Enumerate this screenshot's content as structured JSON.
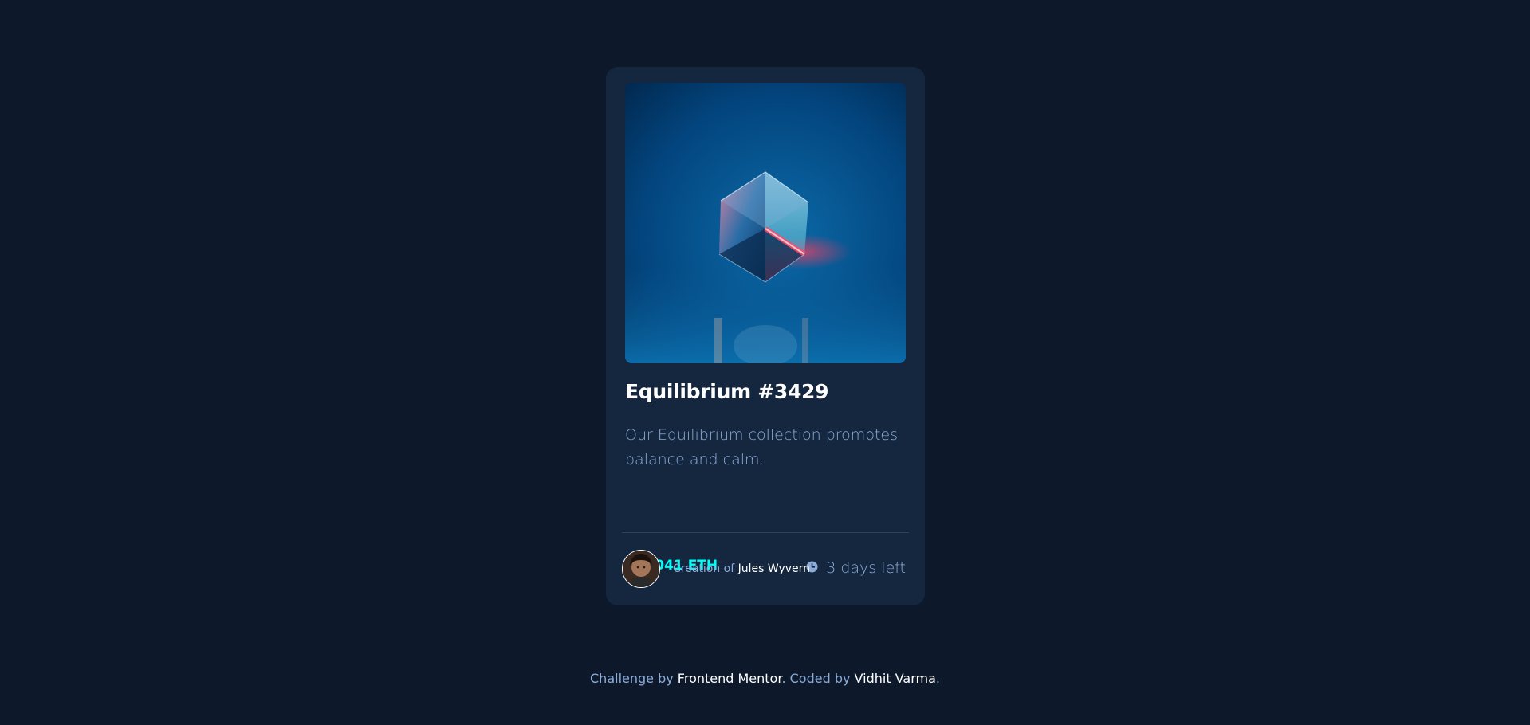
{
  "card": {
    "title": "Equilibrium #3429",
    "description": "Our Equilibrium collection promotes balance and calm.",
    "price": "0.041 ETH",
    "time_left": "3 days left",
    "creator_prefix": "Creation of ",
    "creator_name": "Jules Wyvern"
  },
  "icons": {
    "price": "ethereum-icon",
    "time": "clock-icon"
  },
  "attribution": {
    "challenge_prefix": "Challenge by ",
    "challenge_link": "Frontend Mentor",
    "separator": ". ",
    "coded_prefix": "Coded by ",
    "coded_link": "Vidhit Varma",
    "suffix": "."
  },
  "colors": {
    "page_background": "#0d192b",
    "card_background": "#15263f",
    "accent_cyan": "#00fff8",
    "soft_blue": "#8bacd9",
    "white": "#ffffff",
    "line": "#2e405a"
  }
}
